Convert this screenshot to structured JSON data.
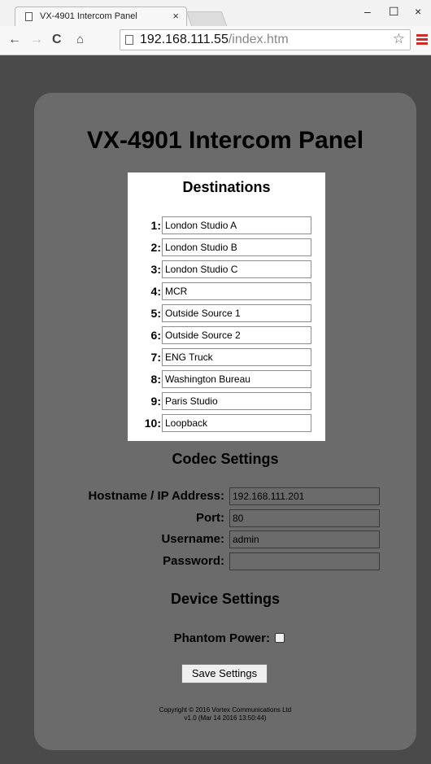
{
  "browser": {
    "tab_title": "VX-4901 Intercom Panel",
    "tab_close": "×",
    "url_host": "192.168.111.55",
    "url_path": "/index.htm",
    "window_minimize": "–",
    "window_maximize": "☐",
    "window_close": "×",
    "menu_color": "#d02c2c"
  },
  "page": {
    "title": "VX-4901 Intercom Panel",
    "destinations_heading": "Destinations",
    "destinations": [
      {
        "num": "1:",
        "value": "London Studio A"
      },
      {
        "num": "2:",
        "value": "London Studio B"
      },
      {
        "num": "3:",
        "value": "London Studio C"
      },
      {
        "num": "4:",
        "value": "MCR"
      },
      {
        "num": "5:",
        "value": "Outside Source 1"
      },
      {
        "num": "6:",
        "value": "Outside Source 2"
      },
      {
        "num": "7:",
        "value": "ENG Truck"
      },
      {
        "num": "8:",
        "value": "Washington Bureau"
      },
      {
        "num": "9:",
        "value": "Paris Studio"
      },
      {
        "num": "10:",
        "value": "Loopback"
      }
    ],
    "codec_heading": "Codec Settings",
    "codec": {
      "hostname_label": "Hostname / IP Address:",
      "hostname_value": "192.168.111.201",
      "port_label": "Port:",
      "port_value": "80",
      "username_label": "Username:",
      "username_value": "admin",
      "password_label": "Password:",
      "password_value": ""
    },
    "device_heading": "Device Settings",
    "device": {
      "phantom_label": "Phantom Power:",
      "phantom_checked": false
    },
    "save_label": "Save Settings",
    "footer_line1": "Copyright © 2016 Vortex Communications Ltd",
    "footer_line2": "v1.0 (Mar 14 2016 13:50:44)"
  }
}
